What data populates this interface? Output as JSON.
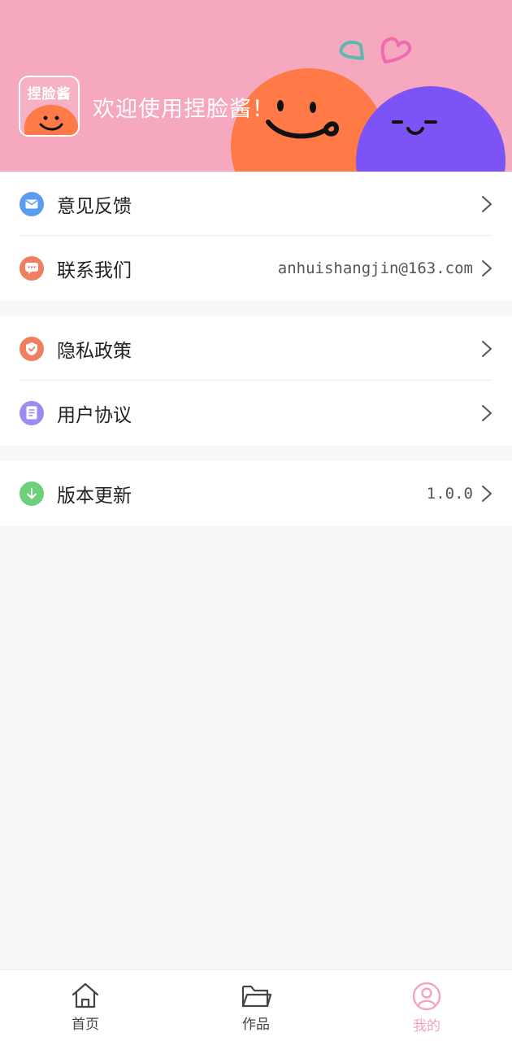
{
  "header": {
    "logo_text": "捏脸酱",
    "welcome": "欢迎使用捏脸酱！"
  },
  "menu": {
    "feedback": {
      "label": "意见反馈",
      "icon": "mail-icon",
      "color": "#5b9cf2"
    },
    "contact": {
      "label": "联系我们",
      "value": "anhuishangjin@163.com",
      "icon": "chat-icon",
      "color": "#f07f5f"
    },
    "privacy": {
      "label": "隐私政策",
      "icon": "shield-icon",
      "color": "#f07f5f"
    },
    "agreement": {
      "label": "用户协议",
      "icon": "document-icon",
      "color": "#9a8cf0"
    },
    "version": {
      "label": "版本更新",
      "value": "1.0.0",
      "icon": "download-icon",
      "color": "#6cd17a"
    }
  },
  "tabbar": {
    "home": "首页",
    "works": "作品",
    "mine": "我的",
    "active_color": "#f4a4bd"
  },
  "colors": {
    "banner": "#f6a8bf",
    "orange_face": "#ff7a46",
    "purple_face": "#7c53f5"
  }
}
